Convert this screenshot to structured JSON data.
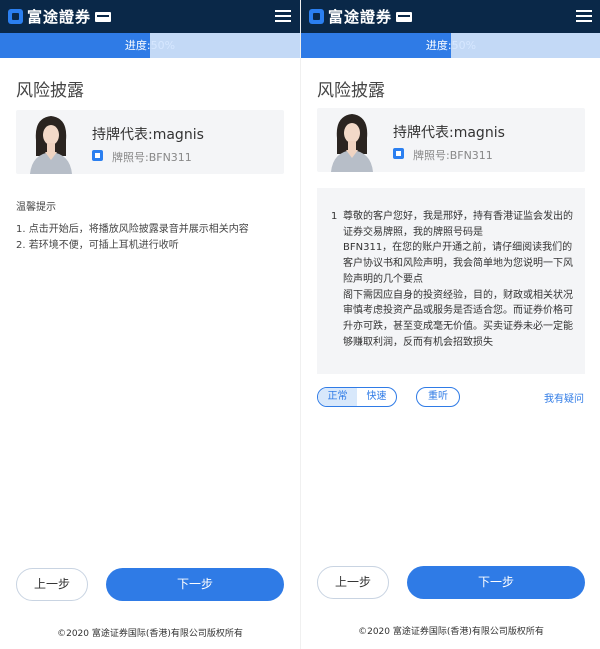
{
  "brand": {
    "name": "富途證券"
  },
  "progress": {
    "label": "进度:",
    "value": "50%",
    "fraction": 0.5
  },
  "page_title": "风险披露",
  "agent": {
    "name": "持牌代表:magnis",
    "license": "牌照号:BFN311"
  },
  "tips": {
    "title": "温馨提示",
    "items": [
      "1. 点击开始后，将播放风险披露录音并展示相关内容",
      "2. 若环境不便，可插上耳机进行收听"
    ]
  },
  "script": {
    "number": "1",
    "text": "尊敬的客户您好，我是邢妤，持有香港证监会发出的证券交易牌照，我的牌照号码是\nBFN311，在您的账户开通之前，请仔细阅读我们的客户协议书和风险声明，我会简单地为您说明一下风险声明的几个要点\n阁下需因应自身的投资经验，目的，财政或相关状况审慎考虑投资产品或服务是否适合您。而证券价格可升亦可跌，甚至变成毫无价值。买卖证券未必一定能够赚取利润，反而有机会招致损失"
  },
  "controls": {
    "normal": "正常",
    "fast": "快速",
    "replay": "重听",
    "question": "我有疑问"
  },
  "buttons": {
    "prev": "上一步",
    "next": "下一步"
  },
  "footer": "©2020 富途证券国际(香港)有限公司版权所有",
  "colors": {
    "header": "#0a2848",
    "accent": "#2f7be6",
    "progress_track": "#c3d9f6"
  }
}
